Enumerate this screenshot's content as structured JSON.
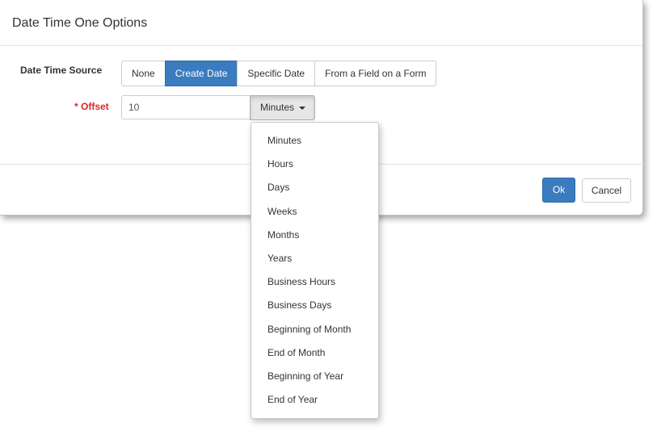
{
  "modal": {
    "title": "Date Time One Options"
  },
  "form": {
    "source_label": "Date Time Source",
    "source_options": [
      "None",
      "Create Date",
      "Specific Date",
      "From a Field on a Form"
    ],
    "source_selected": "Create Date",
    "offset_label": "* Offset",
    "offset_value": "10",
    "unit_selected": "Minutes"
  },
  "unit_dropdown": {
    "items": [
      "Minutes",
      "Hours",
      "Days",
      "Weeks",
      "Months",
      "Years",
      "Business Hours",
      "Business Days",
      "Beginning of Month",
      "End of Month",
      "Beginning of Year",
      "End of Year"
    ],
    "highlighted": [
      "Minutes",
      "Hours"
    ],
    "highlight_color": "#fbf53f"
  },
  "footer": {
    "ok_label": "Ok",
    "cancel_label": "Cancel"
  },
  "colors": {
    "primary": "#3b7bbf",
    "required": "#d9262c"
  }
}
